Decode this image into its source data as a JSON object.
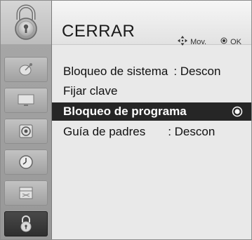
{
  "header": {
    "title": "CERRAR",
    "hint_move": "Mov.",
    "hint_ok": "OK"
  },
  "menu": {
    "items": [
      {
        "label": "Bloqueo de sistema",
        "value": ": Descon"
      },
      {
        "label": "Fijar clave",
        "value": ""
      },
      {
        "label": "Bloqueo de programa",
        "value": ""
      },
      {
        "label": "Guía de padres",
        "value": ": Descon"
      }
    ],
    "selected_index": 2
  },
  "sidebar": {
    "icons": [
      "lock-icon",
      "satellite-dish-icon",
      "tv-screen-icon",
      "speaker-icon",
      "clock-icon",
      "window-icon",
      "lock-icon"
    ],
    "selected_index": 6
  },
  "colors": {
    "selected_row_bg": "#262626",
    "panel_bg": "#e9e9e9",
    "sidebar_bg": "#a3a3a3"
  }
}
